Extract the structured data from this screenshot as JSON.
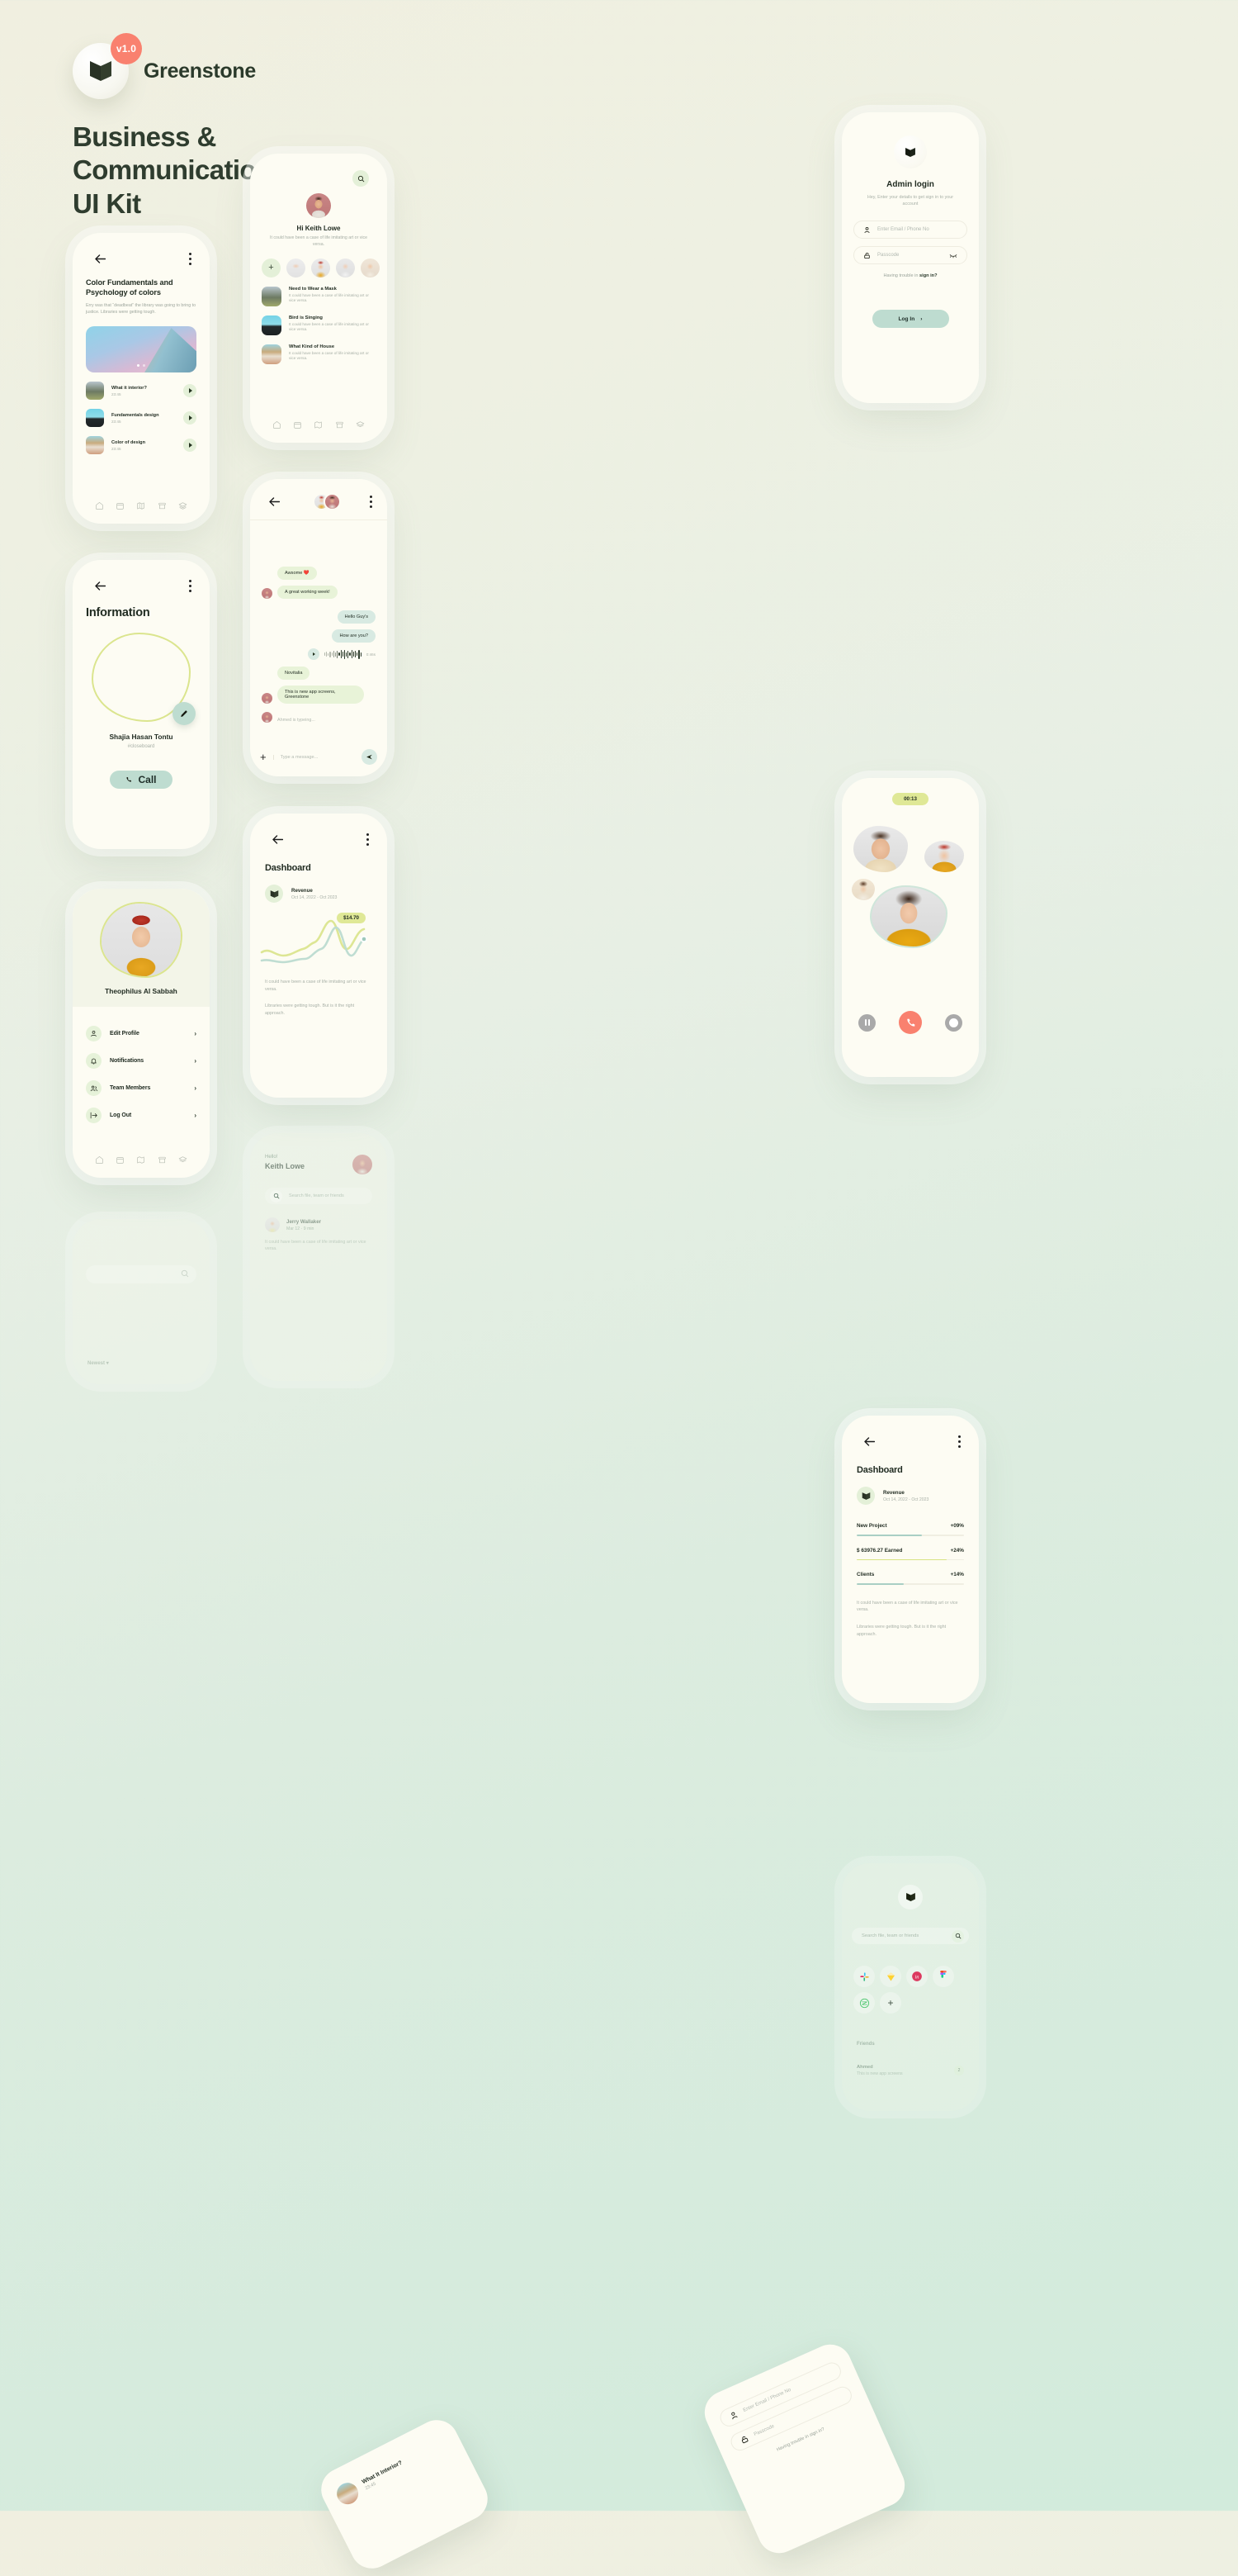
{
  "brand": {
    "version_badge": "v1.0",
    "name": "Greenstone",
    "headline_line1": "Business &",
    "headline_line2": "Communication",
    "headline_line3": "UI Kit",
    "badge_color": "#f9816f",
    "accent_green": "#bedcd0",
    "accent_lime": "#dfe896",
    "page_bg": "#eaf0e3"
  },
  "colors_card": {
    "title": "Color Fundamentals and Psychology of colors",
    "subtitle": "Erry was that “deadbeat” the library was going to bring to justice. Libraries were getting tough.",
    "tracks": [
      {
        "name": "What it interior?",
        "time": "23:45"
      },
      {
        "name": "Fundamentals design",
        "time": "23:45"
      },
      {
        "name": "Color of design",
        "time": "23:45"
      }
    ]
  },
  "info_card": {
    "title": "Information",
    "person_name": "Shajia Hasan Tontu",
    "person_tag": "#closeboard",
    "call_label": "Call"
  },
  "menu_card": {
    "person_name": "Theophilus Al Sabbah",
    "items": [
      {
        "label": "Edit Profile",
        "icon": "user-icon"
      },
      {
        "label": "Notifications",
        "icon": "bell-icon"
      },
      {
        "label": "Team Members",
        "icon": "users-icon"
      },
      {
        "label": "Log Out",
        "icon": "logout-icon"
      }
    ]
  },
  "newest_card": {
    "sort_label": "Newest"
  },
  "feed_card": {
    "greeting": "Hi Keith Lowe",
    "subtitle": "It could have been a case of life imitating art or vice versa.",
    "add_story_label": "+",
    "items": [
      {
        "title": "Need to Wear a Mask",
        "desc": "It could have been a case of life imitating art or vice versa."
      },
      {
        "title": "Bird is Singing",
        "desc": "It could have been a case of life imitating art or vice versa."
      },
      {
        "title": "What Kind of House",
        "desc": "It could have been a case of life imitating art or vice versa."
      }
    ]
  },
  "chat_card": {
    "messages": [
      {
        "side": "them",
        "text": "Awsome ❤️"
      },
      {
        "side": "them",
        "text": "A great working week!"
      },
      {
        "side": "me",
        "text": "Hello Guy's"
      },
      {
        "side": "me",
        "text": "How are you?"
      },
      {
        "side": "them",
        "text": "Novitalia"
      },
      {
        "side": "them",
        "text": "This is new app screens, Greenstone"
      }
    ],
    "voice_duration": "0:46s",
    "typing_status": "Ahmed is typeing...",
    "composer_placeholder": "Type a message..."
  },
  "dashboard_chart": {
    "title": "Dashboard",
    "revenue_label": "Revenue",
    "date_range": "Oct 14, 2022 - Oct 2023",
    "tooltip_value": "$14.70",
    "paragraph1": "It could have been a case of life imitating art or vice versa.",
    "paragraph2": "Libraries were getting tough. But is it the right approach."
  },
  "dashboard_stats": {
    "title": "Dashboard",
    "revenue_label": "Revenue",
    "date_range": "Oct 14, 2022 - Oct 2023",
    "stats": [
      {
        "label": "New Project",
        "value": "+09%",
        "pct": 61,
        "color": "#a9cfc4"
      },
      {
        "label": "$ 63976.27 Earned",
        "value": "+24%",
        "pct": 84,
        "color": "#d8e484"
      },
      {
        "label": "Clients",
        "value": "+14%",
        "pct": 44,
        "color": "#a9cfc4"
      }
    ],
    "paragraph1": "It could have been a case of life imitating art or vice versa.",
    "paragraph2": "Libraries were getting tough. But is it the right approach."
  },
  "login_card": {
    "title": "Admin login",
    "subtitle": "Hey, Enter your details to get sign in to your account",
    "email_placeholder": "Enter Email / Phone No",
    "passcode_placeholder": "Passcode",
    "trouble_text": "Having trouble in ",
    "trouble_link": "sign in?",
    "login_label": "Log In"
  },
  "call_card": {
    "timer": "00:13"
  },
  "hello_card": {
    "greeting_small": "Hello!",
    "greeting_name": "Keith Lowe",
    "search_placeholder": "Search file, team or friends",
    "item_name": "Jerry Wallaker",
    "item_meta": "Mar 12 · 9 min",
    "item_desc": "It could have been a case of life imitating art or vice versa."
  },
  "apps_card": {
    "search_placeholder": "Search file, team or friends",
    "apps": [
      "slack-icon",
      "sketch-icon",
      "invision-icon",
      "figma-icon",
      "zeplin-icon",
      "add-app-icon"
    ],
    "friends_label": "Friends",
    "friend_name": "Ahmed",
    "friend_meta": "This is new app screens",
    "friend_count": "2"
  },
  "float_login": {
    "email_placeholder": "Enter Email / Phone No",
    "passcode_placeholder": "Passcode",
    "trouble": "Having trouble in sign in?"
  },
  "float_track": {
    "name": "What It Interior?",
    "time": "23:45"
  },
  "navbar": {
    "items": [
      "home-icon",
      "calendar-icon",
      "map-icon",
      "archive-icon",
      "layers-icon"
    ]
  },
  "chart_data": {
    "type": "line",
    "title": "Revenue",
    "subtitle": "Oct 14, 2022 - Oct 2023",
    "xlabel": "",
    "ylabel": "",
    "grid": false,
    "legend": "none",
    "annotations": [
      {
        "text": "$14.70",
        "series": "lime",
        "at_x": 9
      }
    ],
    "x": [
      0,
      1,
      2,
      3,
      4,
      5,
      6,
      7,
      8,
      9
    ],
    "series": [
      {
        "name": "lime",
        "color": "#dbe58e",
        "values": [
          22,
          16,
          14,
          18,
          34,
          36,
          66,
          34,
          46,
          56
        ]
      },
      {
        "name": "mint",
        "color": "#bcdbd0",
        "values": [
          10,
          8,
          12,
          16,
          20,
          22,
          50,
          24,
          14,
          34
        ]
      }
    ]
  }
}
